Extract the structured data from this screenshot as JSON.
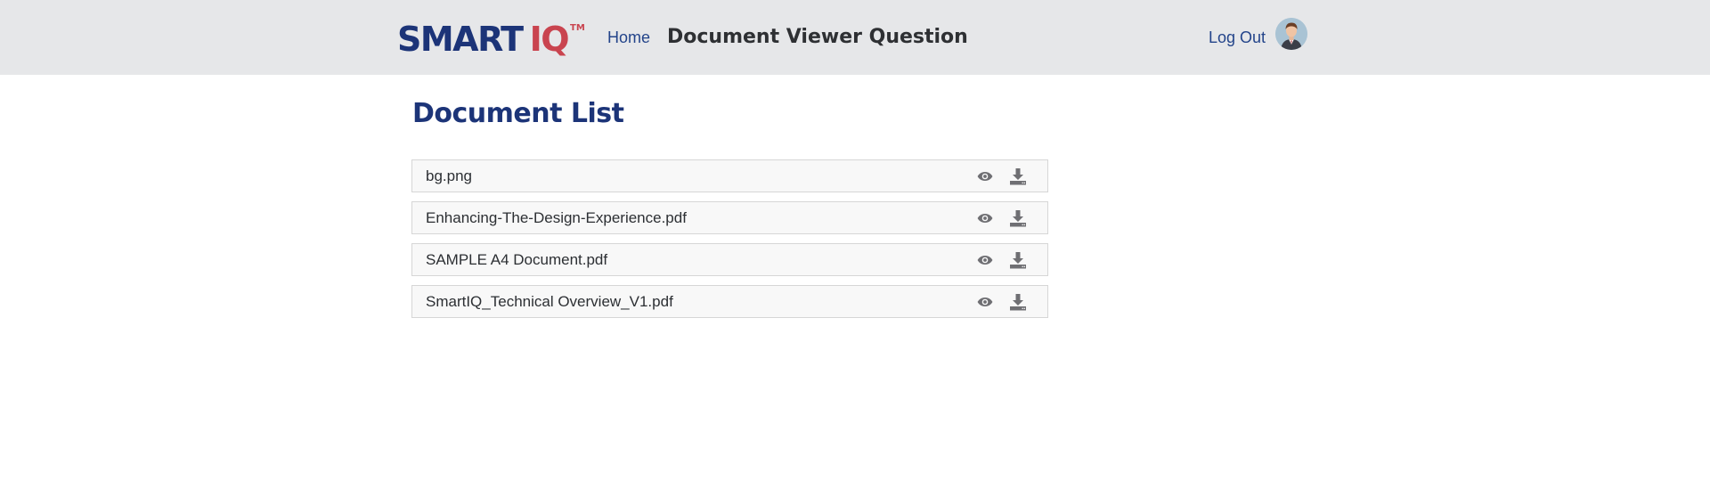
{
  "header": {
    "logo": {
      "text_main": "SMART",
      "text_accent": "IQ",
      "trademark": "TM"
    },
    "home_label": "Home",
    "page_title": "Document Viewer Question",
    "logout_label": "Log Out",
    "avatar_icon": "user-avatar-icon"
  },
  "main": {
    "title": "Document List",
    "documents": [
      {
        "name": "bg.png"
      },
      {
        "name": "Enhancing-The-Design-Experience.pdf"
      },
      {
        "name": "SAMPLE A4 Document.pdf"
      },
      {
        "name": "SmartIQ_Technical Overview_V1.pdf"
      }
    ],
    "row_actions": [
      "eye-icon",
      "download-icon"
    ]
  },
  "colors": {
    "brand_blue": "#1c3478",
    "brand_red": "#c9444f",
    "link_blue": "#23448a",
    "header_bg": "#e6e7e9",
    "icon_gray": "#6f6f73"
  }
}
